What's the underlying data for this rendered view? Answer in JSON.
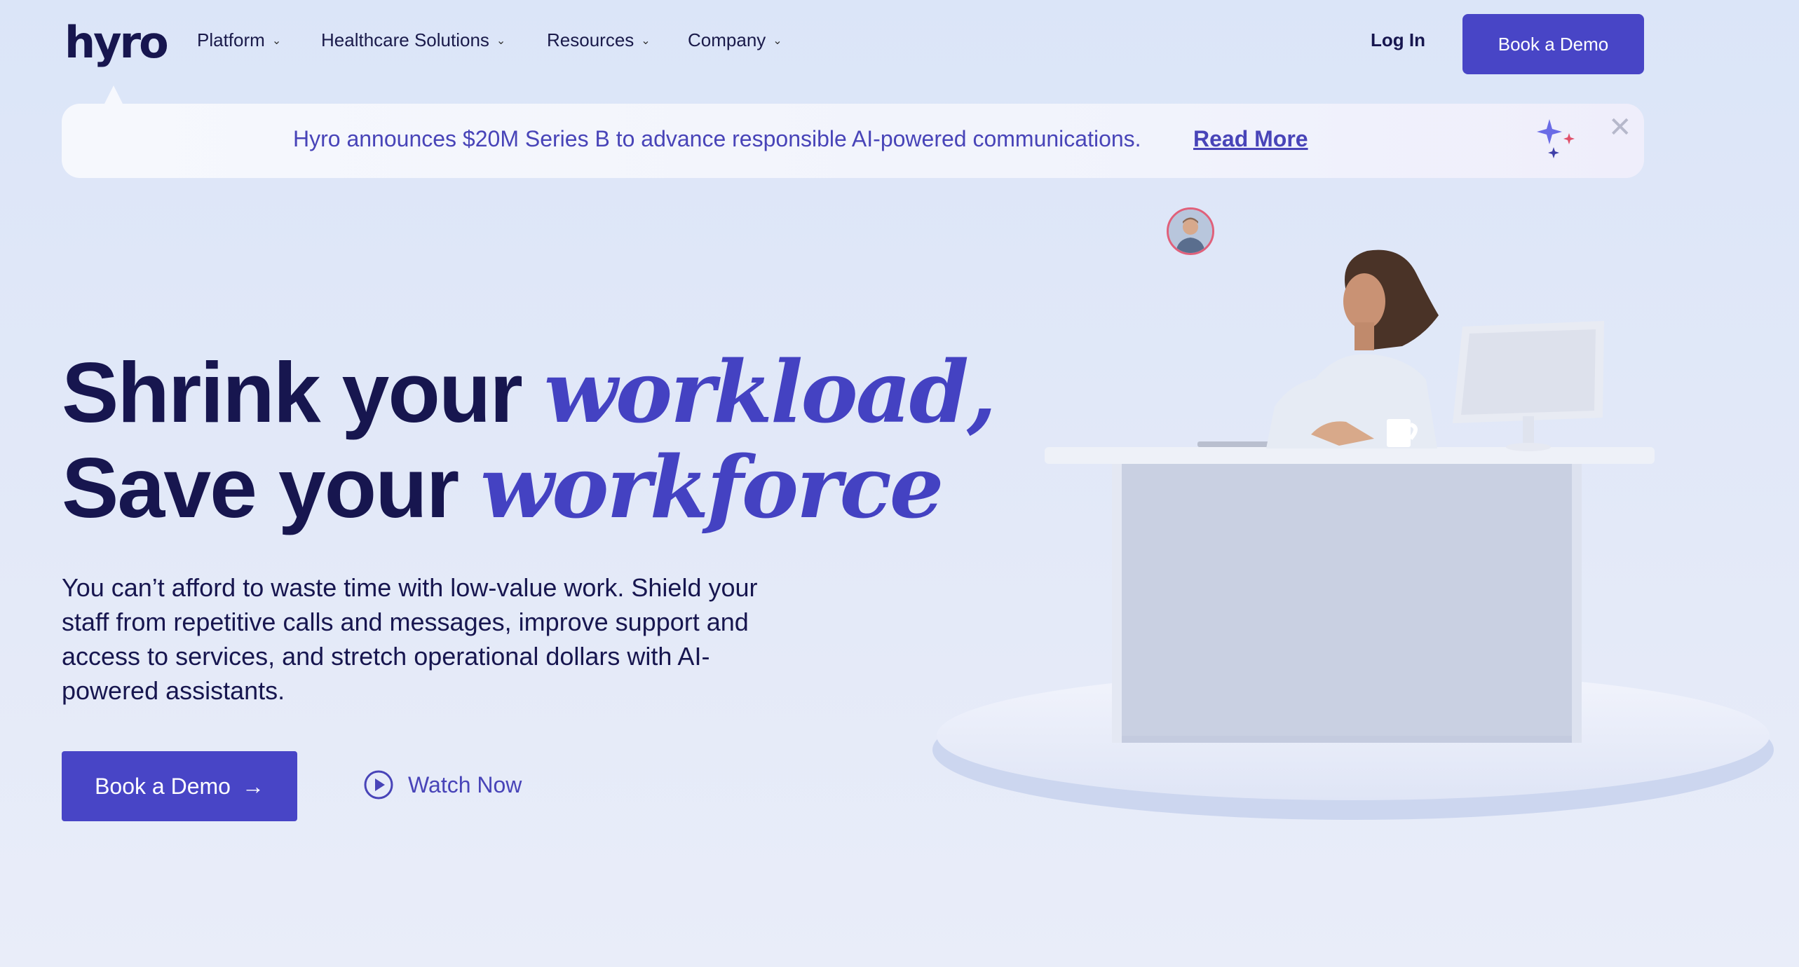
{
  "nav": {
    "logo": "hyro",
    "items": [
      {
        "label": "Platform"
      },
      {
        "label": "Healthcare Solutions"
      },
      {
        "label": "Resources"
      },
      {
        "label": "Company"
      }
    ],
    "login": "Log In",
    "book_demo": "Book a Demo"
  },
  "banner": {
    "text": "Hyro announces $20M Series B to advance responsible AI-powered communications.",
    "link": "Read More"
  },
  "hero": {
    "line1_plain": "Shrink your",
    "line1_em": "workload,",
    "line2_plain": "Save your",
    "line2_em": "workforce",
    "lead": "You can’t afford to waste time with low-value work. Shield your staff from repetitive calls and messages, improve support and access to services, and stretch operational dollars with AI-powered assistants.",
    "cta": "Book a Demo",
    "cta_arrow": "→",
    "watch": "Watch Now"
  },
  "colors": {
    "accent": "#4845c6",
    "navy": "#17164f",
    "background": "#dfe6f8"
  }
}
